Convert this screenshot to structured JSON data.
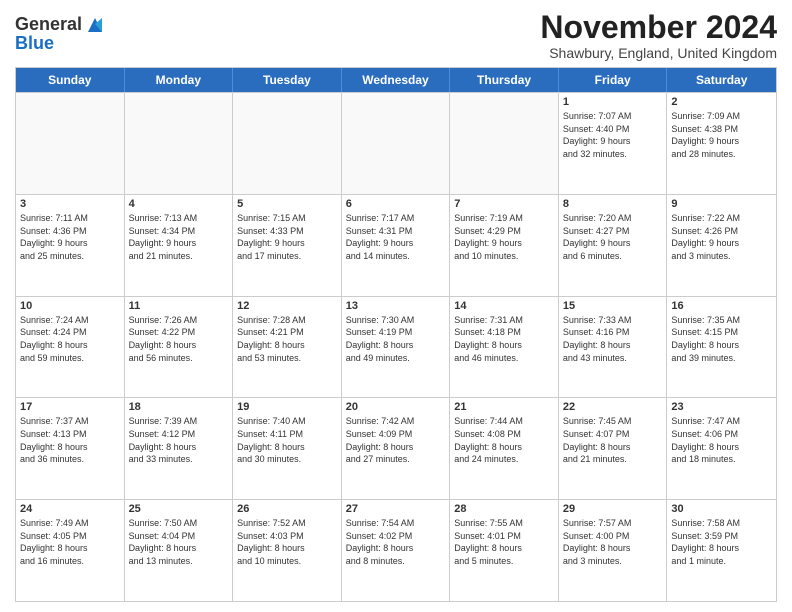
{
  "logo": {
    "general": "General",
    "blue": "Blue"
  },
  "title": "November 2024",
  "location": "Shawbury, England, United Kingdom",
  "days_of_week": [
    "Sunday",
    "Monday",
    "Tuesday",
    "Wednesday",
    "Thursday",
    "Friday",
    "Saturday"
  ],
  "weeks": [
    [
      {
        "day": "",
        "info": ""
      },
      {
        "day": "",
        "info": ""
      },
      {
        "day": "",
        "info": ""
      },
      {
        "day": "",
        "info": ""
      },
      {
        "day": "",
        "info": ""
      },
      {
        "day": "1",
        "info": "Sunrise: 7:07 AM\nSunset: 4:40 PM\nDaylight: 9 hours\nand 32 minutes."
      },
      {
        "day": "2",
        "info": "Sunrise: 7:09 AM\nSunset: 4:38 PM\nDaylight: 9 hours\nand 28 minutes."
      }
    ],
    [
      {
        "day": "3",
        "info": "Sunrise: 7:11 AM\nSunset: 4:36 PM\nDaylight: 9 hours\nand 25 minutes."
      },
      {
        "day": "4",
        "info": "Sunrise: 7:13 AM\nSunset: 4:34 PM\nDaylight: 9 hours\nand 21 minutes."
      },
      {
        "day": "5",
        "info": "Sunrise: 7:15 AM\nSunset: 4:33 PM\nDaylight: 9 hours\nand 17 minutes."
      },
      {
        "day": "6",
        "info": "Sunrise: 7:17 AM\nSunset: 4:31 PM\nDaylight: 9 hours\nand 14 minutes."
      },
      {
        "day": "7",
        "info": "Sunrise: 7:19 AM\nSunset: 4:29 PM\nDaylight: 9 hours\nand 10 minutes."
      },
      {
        "day": "8",
        "info": "Sunrise: 7:20 AM\nSunset: 4:27 PM\nDaylight: 9 hours\nand 6 minutes."
      },
      {
        "day": "9",
        "info": "Sunrise: 7:22 AM\nSunset: 4:26 PM\nDaylight: 9 hours\nand 3 minutes."
      }
    ],
    [
      {
        "day": "10",
        "info": "Sunrise: 7:24 AM\nSunset: 4:24 PM\nDaylight: 8 hours\nand 59 minutes."
      },
      {
        "day": "11",
        "info": "Sunrise: 7:26 AM\nSunset: 4:22 PM\nDaylight: 8 hours\nand 56 minutes."
      },
      {
        "day": "12",
        "info": "Sunrise: 7:28 AM\nSunset: 4:21 PM\nDaylight: 8 hours\nand 53 minutes."
      },
      {
        "day": "13",
        "info": "Sunrise: 7:30 AM\nSunset: 4:19 PM\nDaylight: 8 hours\nand 49 minutes."
      },
      {
        "day": "14",
        "info": "Sunrise: 7:31 AM\nSunset: 4:18 PM\nDaylight: 8 hours\nand 46 minutes."
      },
      {
        "day": "15",
        "info": "Sunrise: 7:33 AM\nSunset: 4:16 PM\nDaylight: 8 hours\nand 43 minutes."
      },
      {
        "day": "16",
        "info": "Sunrise: 7:35 AM\nSunset: 4:15 PM\nDaylight: 8 hours\nand 39 minutes."
      }
    ],
    [
      {
        "day": "17",
        "info": "Sunrise: 7:37 AM\nSunset: 4:13 PM\nDaylight: 8 hours\nand 36 minutes."
      },
      {
        "day": "18",
        "info": "Sunrise: 7:39 AM\nSunset: 4:12 PM\nDaylight: 8 hours\nand 33 minutes."
      },
      {
        "day": "19",
        "info": "Sunrise: 7:40 AM\nSunset: 4:11 PM\nDaylight: 8 hours\nand 30 minutes."
      },
      {
        "day": "20",
        "info": "Sunrise: 7:42 AM\nSunset: 4:09 PM\nDaylight: 8 hours\nand 27 minutes."
      },
      {
        "day": "21",
        "info": "Sunrise: 7:44 AM\nSunset: 4:08 PM\nDaylight: 8 hours\nand 24 minutes."
      },
      {
        "day": "22",
        "info": "Sunrise: 7:45 AM\nSunset: 4:07 PM\nDaylight: 8 hours\nand 21 minutes."
      },
      {
        "day": "23",
        "info": "Sunrise: 7:47 AM\nSunset: 4:06 PM\nDaylight: 8 hours\nand 18 minutes."
      }
    ],
    [
      {
        "day": "24",
        "info": "Sunrise: 7:49 AM\nSunset: 4:05 PM\nDaylight: 8 hours\nand 16 minutes."
      },
      {
        "day": "25",
        "info": "Sunrise: 7:50 AM\nSunset: 4:04 PM\nDaylight: 8 hours\nand 13 minutes."
      },
      {
        "day": "26",
        "info": "Sunrise: 7:52 AM\nSunset: 4:03 PM\nDaylight: 8 hours\nand 10 minutes."
      },
      {
        "day": "27",
        "info": "Sunrise: 7:54 AM\nSunset: 4:02 PM\nDaylight: 8 hours\nand 8 minutes."
      },
      {
        "day": "28",
        "info": "Sunrise: 7:55 AM\nSunset: 4:01 PM\nDaylight: 8 hours\nand 5 minutes."
      },
      {
        "day": "29",
        "info": "Sunrise: 7:57 AM\nSunset: 4:00 PM\nDaylight: 8 hours\nand 3 minutes."
      },
      {
        "day": "30",
        "info": "Sunrise: 7:58 AM\nSunset: 3:59 PM\nDaylight: 8 hours\nand 1 minute."
      }
    ]
  ]
}
